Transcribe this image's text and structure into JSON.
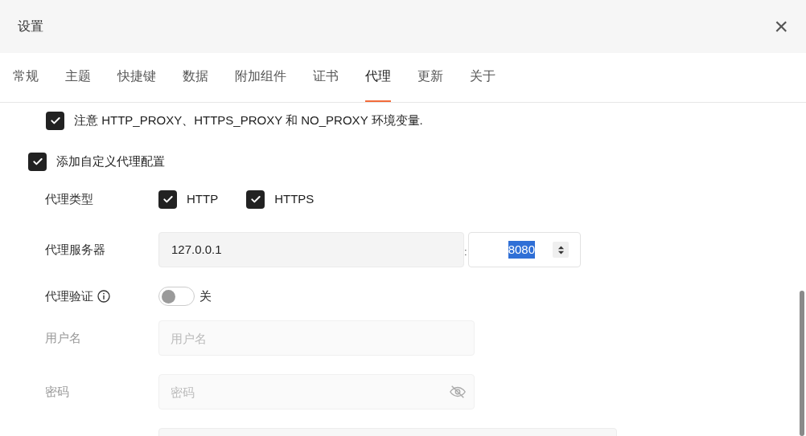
{
  "window": {
    "title": "设置",
    "close": "×"
  },
  "tabs": [
    {
      "label": "常规",
      "selected": false
    },
    {
      "label": "主题",
      "selected": false
    },
    {
      "label": "快捷键",
      "selected": false
    },
    {
      "label": "数据",
      "selected": false
    },
    {
      "label": "附加组件",
      "selected": false
    },
    {
      "label": "证书",
      "selected": false
    },
    {
      "label": "代理",
      "selected": true
    },
    {
      "label": "更新",
      "selected": false
    },
    {
      "label": "关于",
      "selected": false
    }
  ],
  "env_proxy": {
    "label": "注意 HTTP_PROXY、HTTPS_PROXY 和 NO_PROXY 环境变量.",
    "checked": true
  },
  "custom_proxy": {
    "label": "添加自定义代理配置",
    "checked": true
  },
  "proxy_type": {
    "label": "代理类型",
    "options": [
      {
        "label": "HTTP",
        "checked": true
      },
      {
        "label": "HTTPS",
        "checked": true
      }
    ]
  },
  "proxy_server": {
    "label": "代理服务器",
    "host": "127.0.0.1",
    "separator": ":",
    "port": "8080",
    "port_highlighted": true
  },
  "proxy_auth": {
    "label": "代理验证",
    "on": false,
    "state_label": "关"
  },
  "username": {
    "label": "用户名",
    "placeholder": "用户名",
    "disabled": true
  },
  "password": {
    "label": "密码",
    "placeholder": "密码",
    "disabled": true
  }
}
